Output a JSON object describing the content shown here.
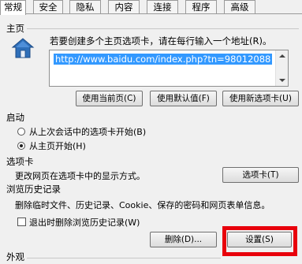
{
  "tabs": [
    "常规",
    "安全",
    "隐私",
    "内容",
    "连接",
    "程序",
    "高级"
  ],
  "home": {
    "title": "主页",
    "instruction": "若要创建多个主页选项卡，请在每行输入一个地址(R)。",
    "url": "http://www.baidu.com/index.php?tn=98012088",
    "use_current": "使用当前页(C)",
    "use_default": "使用默认值(F)",
    "use_new_tab": "使用新选项卡(U)"
  },
  "startup": {
    "title": "启动",
    "option_last": "从上次会话中的选项卡开始(B)",
    "option_home": "从主页开始(H)",
    "selected": "option_home"
  },
  "tabs_section": {
    "title": "选项卡",
    "description": "更改网页在选项卡中的显示方式。",
    "button": "选项卡(T)"
  },
  "history": {
    "title": "浏览历史记录",
    "description": "删除临时文件、历史记录、Cookie、保存的密码和网页表单信息。",
    "checkbox_label": "退出时删除浏览历史记录(W)",
    "checkbox_checked": false,
    "delete_button": "删除(D)...",
    "settings_button": "设置(S)"
  },
  "appearance": {
    "title": "外观"
  },
  "colors": {
    "selection": "#3399ff",
    "highlight_box": "#e8000b"
  }
}
